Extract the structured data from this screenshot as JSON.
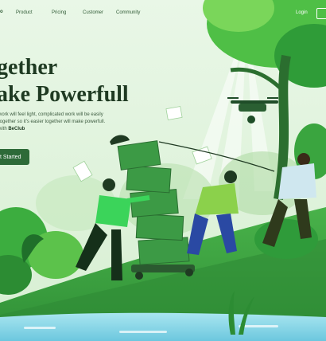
{
  "nav": {
    "logo": "o",
    "items": [
      "Product",
      "Pricing",
      "Customer",
      "Community"
    ],
    "login": "Login"
  },
  "hero": {
    "title_line1": "gether",
    "title_line2": "ake Powerfull",
    "desc_line1": "work will feel light, complicated work will be easily",
    "desc_line2": "together so it's easier together will make powerfull.",
    "desc_line3_prefix": "with ",
    "desc_brand": "BeClub",
    "cta_label": "t Started"
  },
  "colors": {
    "primary": "#2d6a38",
    "title": "#1f3a22",
    "leaf_light": "#62c84f",
    "leaf_dark": "#1f7a2e",
    "water": "#7fd0e6"
  }
}
